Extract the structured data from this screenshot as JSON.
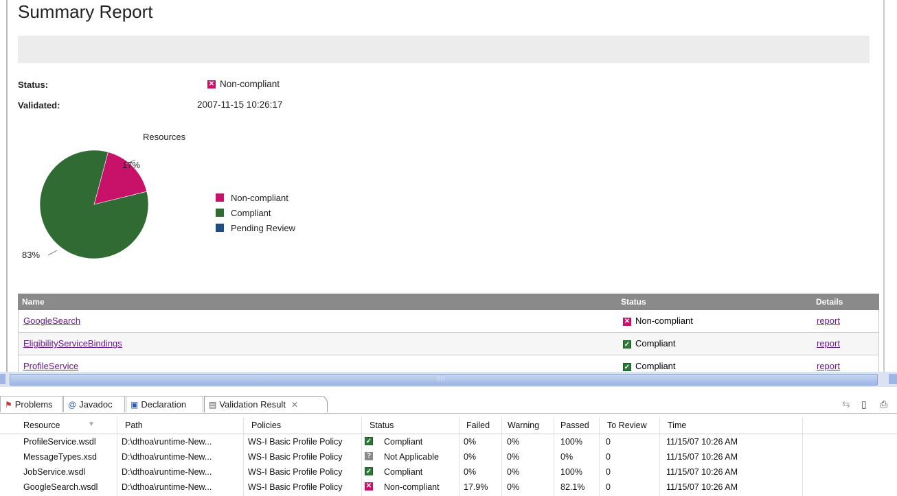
{
  "report": {
    "title": "Summary Report",
    "status_label": "Status:",
    "status_value": "Non-compliant",
    "validated_label": "Validated:",
    "validated_value": "2007-11-15 10:26:17",
    "chart_title": "Resources",
    "legend": [
      "Non-compliant",
      "Compliant",
      "Pending Review"
    ],
    "table": {
      "headers": [
        "Name",
        "Status",
        "Details"
      ],
      "rows": [
        {
          "name": "GoogleSearch",
          "status": "Non-compliant",
          "status_icon": "x-icon",
          "details": "report"
        },
        {
          "name": "EligibilityServiceBindings",
          "status": "Compliant",
          "status_icon": "check-icon",
          "details": "report"
        },
        {
          "name": "ProfileService",
          "status": "Compliant",
          "status_icon": "check-icon",
          "details": "report"
        }
      ]
    }
  },
  "chart_data": {
    "type": "pie",
    "title": "Resources",
    "categories": [
      "Non-compliant",
      "Compliant",
      "Pending Review"
    ],
    "values": [
      17,
      83,
      0
    ],
    "labels": [
      "17%",
      "83%"
    ],
    "colors": [
      "#c8126a",
      "#2f6b32",
      "#1c4f7e"
    ],
    "legend_position": "right"
  },
  "tabs": [
    {
      "label": "Problems",
      "icon": "problems-icon"
    },
    {
      "label": "Javadoc",
      "icon": "at-icon"
    },
    {
      "label": "Declaration",
      "icon": "declaration-icon"
    },
    {
      "label": "Validation Result",
      "icon": "validation-icon",
      "active": true
    }
  ],
  "results": {
    "columns": [
      "Resource",
      "Path",
      "Policies",
      "Status",
      "Failed",
      "Warning",
      "Passed",
      "To Review",
      "Time"
    ],
    "rows": [
      {
        "resource": "ProfileService.wsdl",
        "path": "D:\\dthoa\\runtime-New...",
        "policy": "WS-I Basic Profile Policy",
        "status": "Compliant",
        "status_icon": "check-icon",
        "failed": "0%",
        "warning": "0%",
        "passed": "100%",
        "review": "0",
        "time": "11/15/07 10:26 AM"
      },
      {
        "resource": "MessageTypes.xsd",
        "path": "D:\\dthoa\\runtime-New...",
        "policy": "WS-I Basic Profile Policy",
        "status": "Not Applicable",
        "status_icon": "na-icon",
        "failed": "0%",
        "warning": "0%",
        "passed": "0%",
        "review": "0",
        "time": "11/15/07 10:26 AM"
      },
      {
        "resource": "JobService.wsdl",
        "path": "D:\\dthoa\\runtime-New...",
        "policy": "WS-I Basic Profile Policy",
        "status": "Compliant",
        "status_icon": "check-icon",
        "failed": "0%",
        "warning": "0%",
        "passed": "100%",
        "review": "0",
        "time": "11/15/07 10:26 AM"
      },
      {
        "resource": "GoogleSearch.wsdl",
        "path": "D:\\dthoa\\runtime-New...",
        "policy": "WS-I Basic Profile Policy",
        "status": "Non-compliant",
        "status_icon": "x-icon",
        "failed": "17.9%",
        "warning": "0%",
        "passed": "82.1%",
        "review": "0",
        "time": "11/15/07 10:26 AM"
      }
    ]
  }
}
